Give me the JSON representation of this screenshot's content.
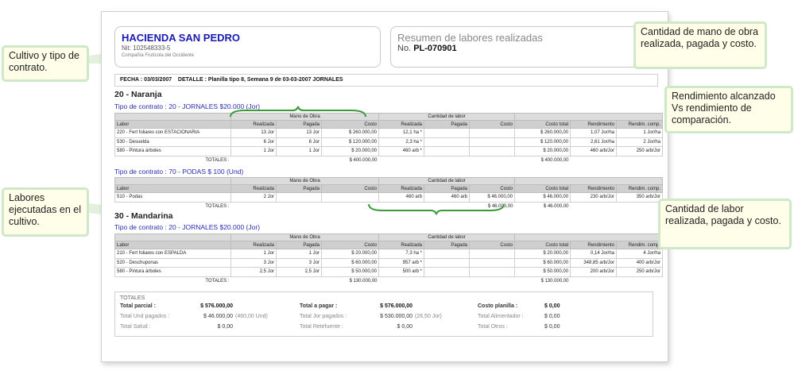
{
  "company": {
    "name": "HACIENDA SAN PEDRO",
    "nit": "Nit: 102548333-5",
    "description": "Compañía Frutícola del Occidente"
  },
  "summary": {
    "title": "Resumen de labores realizadas",
    "no_label": "No.",
    "no_value": "PL-070901"
  },
  "fecha": {
    "label": "FECHA :",
    "value": "03/03/2007",
    "detalle_label": "DETALLE :",
    "detalle_value": "Planilla tipo 8, Semana 9 de 03-03-2007 JORNALES"
  },
  "headers": {
    "group_mano": "Mano de Obra",
    "group_cantidad": "Cantidad de labor",
    "labor": "Labor",
    "realizada": "Realizada",
    "pagada": "Pagada",
    "costo": "Costo",
    "costo_total": "Costo total",
    "rendimiento": "Rendimiento",
    "rendim_comp": "Rendim. comp.",
    "totales": "TOTALES :"
  },
  "crops": [
    {
      "title": "20 - Naranja",
      "contracts": [
        {
          "label": "Tipo de contrato :",
          "value": "20 - JORNALES $20.000 (Jor)",
          "rows": [
            [
              "220 - Fert foliares con ESTACIONARIA",
              "13 Jor",
              "13 Jor",
              "$ 260.000,00",
              "12,1 ha *",
              "",
              "",
              "$ 260.000,00",
              "1,07 Jor/ha",
              "1 Jor/ha"
            ],
            [
              "530 - Desuelda",
              "6 Jor",
              "6 Jor",
              "$ 120.000,00",
              "2,3 ha *",
              "",
              "",
              "$ 120.000,00",
              "2,61 Jor/ha",
              "2 Jor/ha"
            ],
            [
              "580 - Pintura árboles",
              "1 Jor",
              "1 Jor",
              "$ 20.000,00",
              "460 arb *",
              "",
              "",
              "$ 20.000,00",
              "460 arb/Jor",
              "250 arb/Jor"
            ]
          ],
          "totals": [
            "",
            "",
            "$ 400.000,00",
            "",
            "",
            "",
            "$ 400.000,00",
            "",
            ""
          ]
        },
        {
          "label": "Tipo de contrato :",
          "value": "70 - PODAS $ 100 (Und)",
          "rows": [
            [
              "510 - Podas",
              "2 Jor",
              "",
              "",
              "460 arb",
              "460 arb",
              "$ 46.000,00",
              "$ 46.000,00",
              "230 arb/Jor",
              "350 arb/Jor"
            ]
          ],
          "totals": [
            "",
            "",
            "",
            "",
            "",
            "$ 46.000,00",
            "$ 46.000,00",
            "",
            ""
          ]
        }
      ]
    },
    {
      "title": "30 - Mandarina",
      "contracts": [
        {
          "label": "Tipo de contrato :",
          "value": "20 - JORNALES $20.000 (Jor)",
          "rows": [
            [
              "210 - Fert foliares con ESPALDA",
              "1 Jor",
              "1 Jor",
              "$ 20.000,00",
              "7,3 ha *",
              "",
              "",
              "$ 20.000,00",
              "0,14 Jor/ha",
              "4 Jor/ha"
            ],
            [
              "520 - Deschuponas",
              "3 Jor",
              "3 Jor",
              "$ 60.000,00",
              "957 arb *",
              "",
              "",
              "$ 60.000,00",
              "348,85 arb/Jor",
              "400 arb/Jor"
            ],
            [
              "580 - Pintura árboles",
              "2,5 Jor",
              "2,5 Jor",
              "$ 50.000,00",
              "500 arb *",
              "",
              "",
              "$ 50.000,00",
              "200 arb/Jor",
              "250 arb/Jor"
            ]
          ],
          "totals": [
            "",
            "",
            "$ 130.000,00",
            "",
            "",
            "",
            "$ 130.000,00",
            "",
            ""
          ]
        }
      ]
    }
  ],
  "totals": {
    "title": "TOTALES",
    "total_parcial_label": "Total parcial :",
    "total_parcial": "$ 576.000,00",
    "total_und_label": "Total Und pagados :",
    "total_und": "$ 46.000,00",
    "total_und_extra": "(460,00 Und)",
    "total_salud_label": "Total Salud :",
    "total_salud": "$ 0,00",
    "total_pagar_label": "Total a pagar :",
    "total_pagar": "$ 576.000,00",
    "total_jor_label": "Total Jor pagados :",
    "total_jor": "$ 530.000,00",
    "total_jor_extra": "(26,50 Jor)",
    "total_retef_label": "Total Retefuente :",
    "total_retef": "$ 0,00",
    "costo_planilla_label": "Costo planilla :",
    "costo_planilla": "$ 0,00",
    "total_alim_label": "Total Alimentador :",
    "total_alim": "$ 0,00",
    "total_otros_label": "Total Otros :",
    "total_otros": "$ 0,00"
  },
  "callouts": {
    "cultivo": "Cultivo y tipo de contrato.",
    "labores": "Labores ejecutadas en el cultivo.",
    "mano_obra": "Cantidad de mano de obra realizada, pagada y costo.",
    "rendimiento": "Rendimiento alcanzado Vs rendimiento de comparación.",
    "cantidad_labor": "Cantidad de labor realizada, pagada y costo."
  },
  "colors": {
    "brace": "#3a9a3a",
    "callout_border": "#cfe8c8",
    "callout_bg": "#fffee8",
    "link": "#2a2ab0"
  }
}
